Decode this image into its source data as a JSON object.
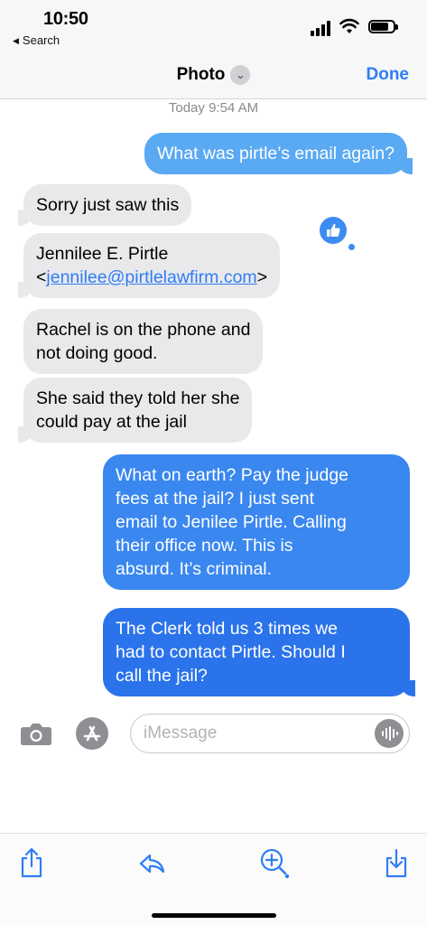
{
  "status_bar": {
    "time": "10:50",
    "back_app": "Search"
  },
  "nav": {
    "title": "Photo",
    "done_label": "Done"
  },
  "conversation": {
    "timestamp": "Today 9:54 AM",
    "messages": [
      {
        "direction": "outgoing",
        "lines": [
          "What was pirtle’s email again?"
        ]
      },
      {
        "direction": "incoming",
        "lines": [
          "Sorry just saw this"
        ]
      },
      {
        "direction": "incoming",
        "name_line": "Jennilee E. Pirtle",
        "email_prefix": "<",
        "email": "jennilee@pirtlelawfirm.com",
        "email_suffix": ">",
        "tapback": "thumbs-up"
      },
      {
        "direction": "incoming",
        "lines": [
          "Rachel is on the phone and",
          "not doing good."
        ]
      },
      {
        "direction": "incoming",
        "lines": [
          "She said they told her she",
          "could pay at the jail"
        ]
      },
      {
        "direction": "outgoing",
        "lines": [
          "What on earth? Pay the judge",
          "fees at the jail? I just sent",
          "email to Jenilee Pirtle. Calling",
          "their office now. This is",
          "absurd. It’s criminal."
        ]
      },
      {
        "direction": "outgoing",
        "lines": [
          "The Clerk told us 3 times we",
          "had to contact Pirtle. Should I",
          "call the jail?"
        ]
      }
    ]
  },
  "composer": {
    "placeholder": "iMessage",
    "value": ""
  },
  "toolbar": {
    "icons": [
      "share-icon",
      "reply-icon",
      "zoom-in-icon",
      "save-icon"
    ]
  },
  "colors": {
    "accent": "#2f7df6",
    "incoming_bubble": "#e9e9eb",
    "outgoing_bubble_top": "#5aa9f3",
    "outgoing_bubble_bottom": "#2b73ea"
  }
}
